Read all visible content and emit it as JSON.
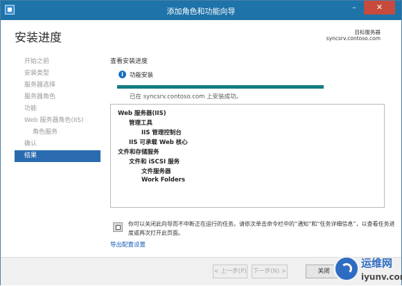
{
  "window": {
    "title": "添加角色和功能向导",
    "minimize": "–",
    "close": "✕"
  },
  "header": {
    "page_title": "安装进度",
    "dest_label": "目标服务器",
    "dest_server": "syncsrv.contoso.com"
  },
  "sidebar": {
    "items": [
      {
        "label": "开始之前",
        "state": "disabled"
      },
      {
        "label": "安装类型",
        "state": "disabled"
      },
      {
        "label": "服务器选择",
        "state": "disabled"
      },
      {
        "label": "服务器角色",
        "state": "disabled"
      },
      {
        "label": "功能",
        "state": "disabled"
      },
      {
        "label": "Web 服务器角色(IIS)",
        "state": "disabled"
      },
      {
        "label": "角色服务",
        "state": "disabled"
      },
      {
        "label": "确认",
        "state": "disabled"
      },
      {
        "label": "结果",
        "state": "active"
      }
    ]
  },
  "main": {
    "section_label": "查看安装进度",
    "install_label": "功能安装",
    "progress_value": 1.0,
    "progress_color": "#117c82",
    "success_text": "已在 syncsrv.contoso.com 上安装成功。",
    "results": [
      {
        "text": "Web 服务器(IIS)",
        "level": 0
      },
      {
        "text": "管理工具",
        "level": 1
      },
      {
        "text": "IIS 管理控制台",
        "level": 2
      },
      {
        "text": "IIS 可承载 Web 核心",
        "level": 1
      },
      {
        "text": "文件和存储服务",
        "level": 0
      },
      {
        "text": "文件和 iSCSI 服务",
        "level": 1
      },
      {
        "text": "文件服务器",
        "level": 2
      },
      {
        "text": "Work Folders",
        "level": 2
      }
    ],
    "notice": "你可以关闭此向导而不中断正在运行的任务。请依次单击命令栏中的“通知”和“任务详细信息”，以查看任务进度或再次打开此页面。",
    "export_link": "导出配置设置"
  },
  "footer": {
    "prev": "< 上一步(P)",
    "next": "下一步(N) >",
    "close": "关闭"
  },
  "watermark": {
    "title": "运维网",
    "subtitle": "iyunv.com"
  },
  "colors": {
    "titlebar": "#1e73a8",
    "active_nav": "#2a6bb0",
    "link": "#1a5fb4"
  }
}
